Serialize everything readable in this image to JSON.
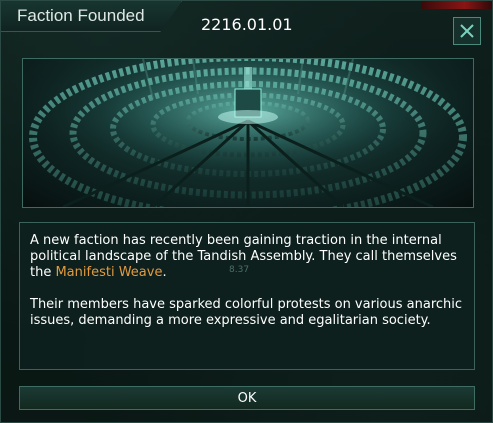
{
  "dialog": {
    "title": "Faction Founded",
    "date": "2216.01.01",
    "ghost_number": "8.37",
    "banner_image": "assembly-chamber",
    "paragraph1_before": "A new faction has recently been gaining traction in the internal political landscape of the Tandish Assembly. They call themselves the ",
    "faction_name": "Manifesti Weave",
    "paragraph1_after": ".",
    "paragraph2": "Their members have sparked colorful protests on various anarchic issues, demanding a more expressive and egalitarian society.",
    "ok_label": "OK",
    "close_icon": "close-icon"
  },
  "colors": {
    "accent": "#4a8a7c",
    "highlight": "#e39a3f",
    "text": "#ffffff"
  }
}
